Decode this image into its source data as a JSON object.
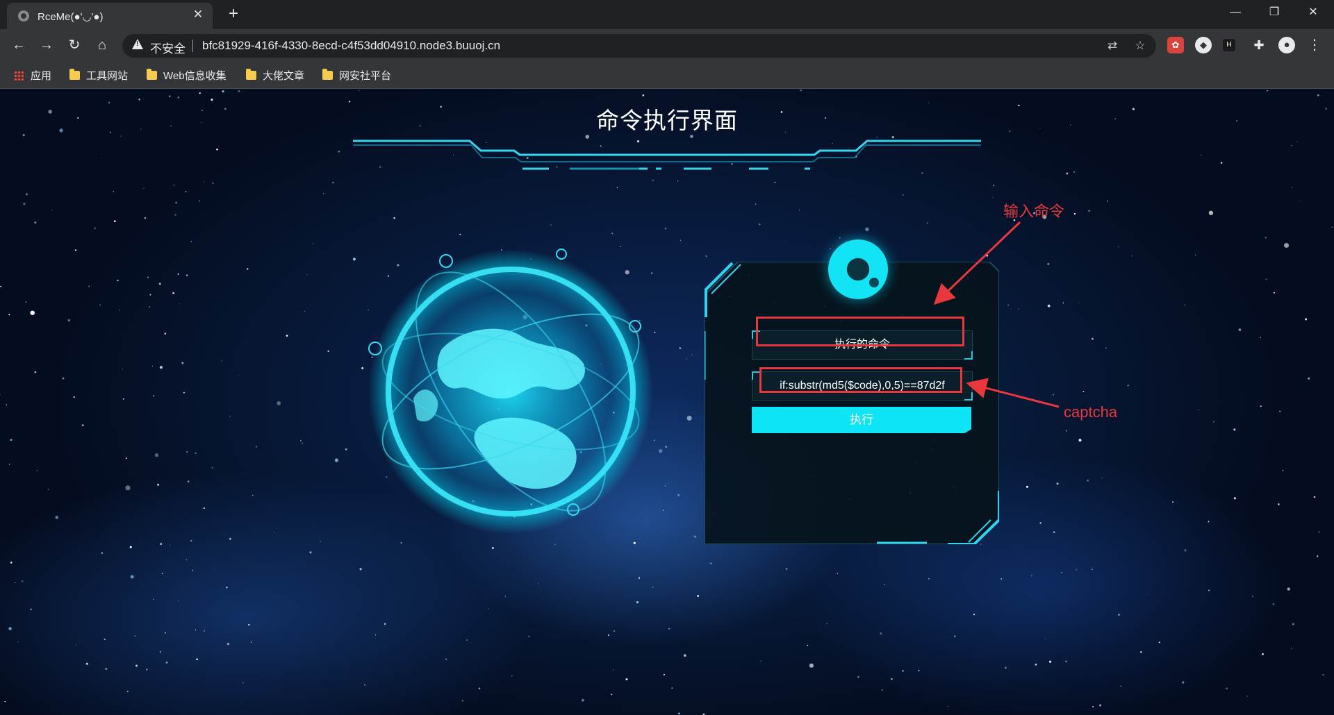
{
  "browser": {
    "tab_title": "RceMe(●'◡'●)",
    "tab_close": "✕",
    "new_tab": "+",
    "window_controls": {
      "minimize": "—",
      "restore": "❐",
      "close": "✕"
    },
    "address": {
      "security_label": "不安全",
      "url": "bfc81929-416f-4330-8ecd-c4f53dd04910.node3.buuoj.cn"
    },
    "nav": {
      "back": "←",
      "forward": "→",
      "reload": "↻",
      "home": "⌂"
    },
    "omnibox_icons": {
      "translate": "⇄",
      "bookmark_star": "☆"
    },
    "extensions": [
      "ext-red-icon",
      "ext-shield-icon",
      "ext-dark-icon",
      "puzzle-icon",
      "profile-icon",
      "menu-icon"
    ],
    "extension_glyphs": {
      "puzzle": "✚",
      "profile": "●",
      "menu": "⋮",
      "dark": "H",
      "shield": "◆",
      "red": "✿"
    },
    "bookmarks": [
      {
        "label": "应用",
        "icon": "apps-grid-icon"
      },
      {
        "label": "工具网站",
        "icon": "folder-icon"
      },
      {
        "label": "Web信息收集",
        "icon": "folder-icon"
      },
      {
        "label": "大佬文章",
        "icon": "folder-icon"
      },
      {
        "label": "网安社平台",
        "icon": "folder-icon"
      }
    ]
  },
  "page": {
    "title": "命令执行界面",
    "form": {
      "command_placeholder": "执行的命令",
      "captcha_placeholder": "if:substr(md5($code),0,5)==87d2f",
      "submit_label": "执行"
    },
    "annotations": {
      "command_note": "输入命令",
      "captcha_note": "captcha",
      "color": "#e8383d"
    },
    "accent_color": "#0de4f5"
  }
}
